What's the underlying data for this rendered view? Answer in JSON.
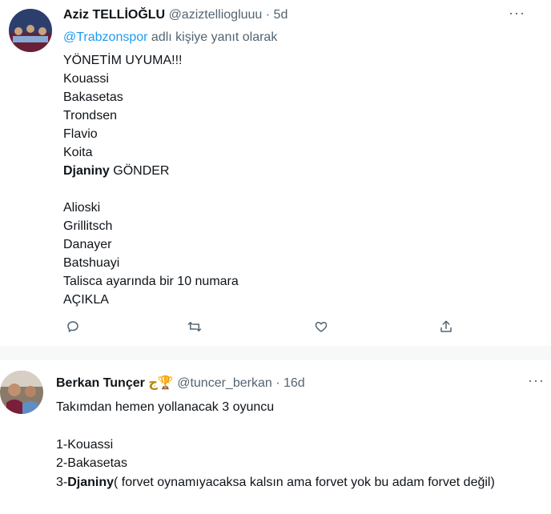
{
  "tweet1": {
    "author_name": "Aziz TELLİOĞLU",
    "author_handle": "@aziztelliogluuu",
    "separator": "·",
    "time": "5d",
    "more": "···",
    "reply_handle": "@Trabzonspor",
    "reply_suffix": "adlı kişiye yanıt olarak",
    "lines": [
      "YÖNETİM UYUMA!!!",
      "Kouassi",
      "Bakasetas",
      "Trondsen",
      "Flavio",
      "Koita"
    ],
    "bold_name": "Djaniny",
    "bold_suffix": "GÖNDER",
    "lines2": [
      "Alioski",
      "Grillitsch",
      "Danayer",
      "Batshuayi",
      "Talisca ayarında bir 10 numara",
      "AÇIKLA"
    ],
    "actions": [
      "reply-icon",
      "retweet-icon",
      "like-icon",
      "share-icon"
    ]
  },
  "tweet2": {
    "author_name": "Berkan Tunçer",
    "badge": "ج🏆",
    "author_handle": "@tuncer_berkan",
    "separator": "·",
    "time": "16d",
    "more": "···",
    "line1": "Takımdan hemen yollanacak 3 oyuncu",
    "item1": "1-Kouassi",
    "item2": "2-Bakasetas",
    "item3_prefix": "3-",
    "item3_bold": "Djaniny",
    "item3_rest": "( forvet oynamıyacaksa kalsın ama forvet yok bu adam forvet değil)"
  },
  "colors": {
    "link": "#1d9bf0",
    "muted": "#536471",
    "text": "#0f1419"
  }
}
